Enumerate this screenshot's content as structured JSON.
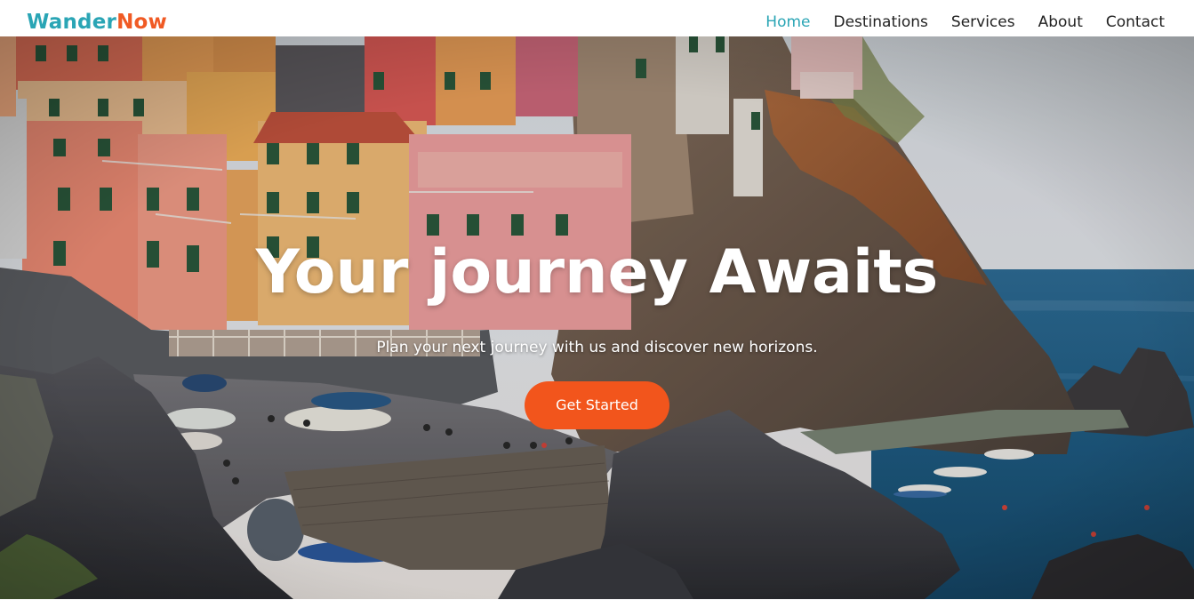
{
  "brand": {
    "name_part1": "Wander",
    "name_part2": "Now",
    "color_part1": "#2aa5b5",
    "color_part2": "#f05a24"
  },
  "nav": {
    "items": [
      {
        "label": "Home",
        "active": true
      },
      {
        "label": "Destinations",
        "active": false
      },
      {
        "label": "Services",
        "active": false
      },
      {
        "label": "About",
        "active": false
      },
      {
        "label": "Contact",
        "active": false
      }
    ],
    "active_color": "#2aa5b5"
  },
  "hero": {
    "title": "Your journey Awaits",
    "subtitle": "Plan your next journey with us and discover new horizons.",
    "cta_label": "Get Started",
    "cta_color": "#f2551c",
    "background_image": "coastal-cliff-village-photo"
  }
}
